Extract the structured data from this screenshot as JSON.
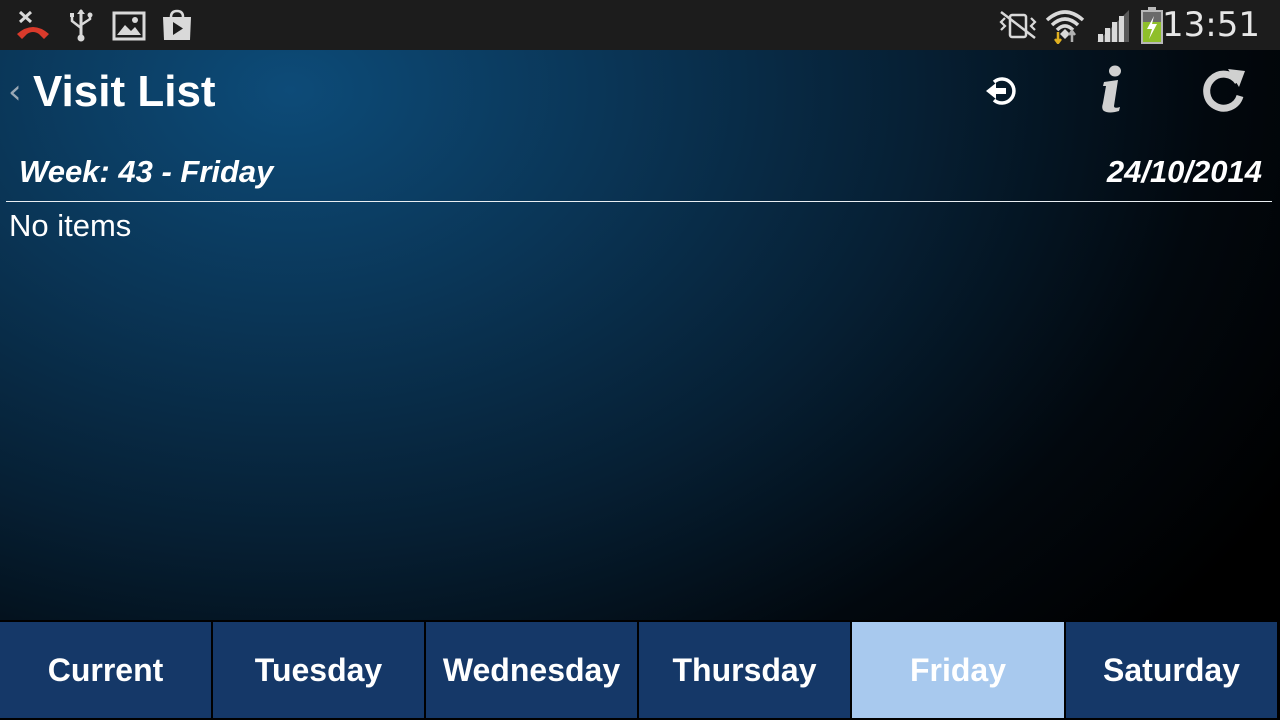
{
  "status_bar": {
    "time": "13:51",
    "left_icons": [
      "missed-call-icon",
      "usb-icon",
      "gallery-icon",
      "play-store-icon"
    ],
    "right_icons": [
      "vibrate-icon",
      "wifi-icon",
      "signal-icon",
      "battery-charging-icon"
    ]
  },
  "header": {
    "back_icon": "back-chevron-icon",
    "title": "Visit List",
    "actions": [
      "logout-icon",
      "info-icon",
      "refresh-icon"
    ]
  },
  "subheader": {
    "week": "Week: 43 - Friday",
    "date": "24/10/2014"
  },
  "content": {
    "empty_text": "No items"
  },
  "tabs": [
    {
      "label": "Current",
      "selected": false
    },
    {
      "label": "Tuesday",
      "selected": false
    },
    {
      "label": "Wednesday",
      "selected": false
    },
    {
      "label": "Thursday",
      "selected": false
    },
    {
      "label": "Friday",
      "selected": true
    },
    {
      "label": "Saturday",
      "selected": false
    }
  ],
  "colors": {
    "tab_bg": "#153868",
    "tab_selected_bg": "#a8c9ee",
    "title_text": "#ffffff",
    "status_bar_bg": "#1c1c1c"
  }
}
